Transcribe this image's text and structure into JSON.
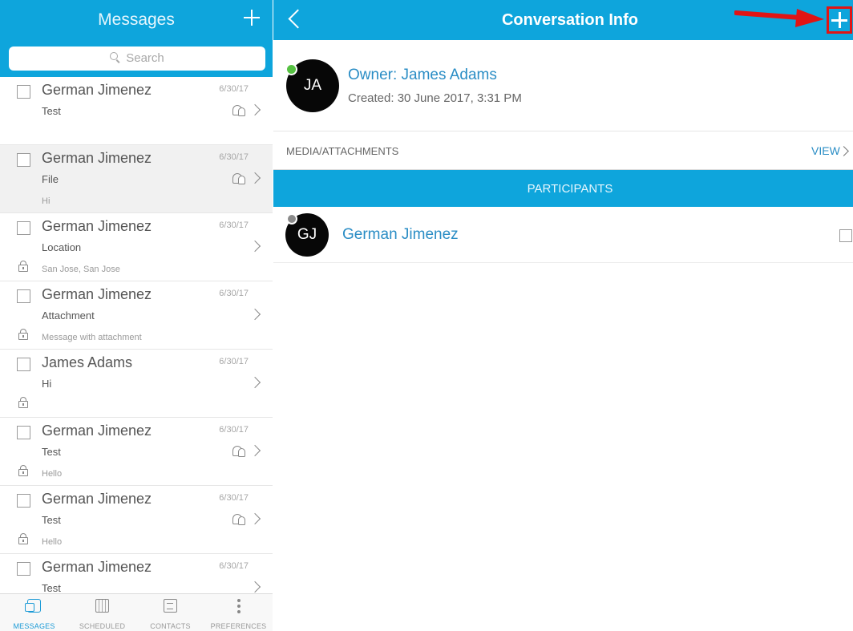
{
  "left": {
    "title": "Messages",
    "search_placeholder": "Search",
    "messages": [
      {
        "sender": "German Jimenez",
        "date": "6/30/17",
        "subject": "Test",
        "preview": "",
        "group": true,
        "lock": false,
        "selected": false
      },
      {
        "sender": "German Jimenez",
        "date": "6/30/17",
        "subject": "File",
        "preview": "Hi",
        "group": true,
        "lock": false,
        "selected": true
      },
      {
        "sender": "German Jimenez",
        "date": "6/30/17",
        "subject": "Location",
        "preview": "San Jose, San Jose",
        "group": false,
        "lock": true,
        "selected": false
      },
      {
        "sender": "German Jimenez",
        "date": "6/30/17",
        "subject": "Attachment",
        "preview": "Message with attachment",
        "group": false,
        "lock": true,
        "selected": false
      },
      {
        "sender": "James Adams",
        "date": "6/30/17",
        "subject": "Hi",
        "preview": "",
        "group": false,
        "lock": true,
        "selected": false
      },
      {
        "sender": "German Jimenez",
        "date": "6/30/17",
        "subject": "Test",
        "preview": "Hello",
        "group": true,
        "lock": true,
        "selected": false
      },
      {
        "sender": "German Jimenez",
        "date": "6/30/17",
        "subject": "Test",
        "preview": "Hello",
        "group": true,
        "lock": true,
        "selected": false
      },
      {
        "sender": "German Jimenez",
        "date": "6/30/17",
        "subject": "Test",
        "preview": "",
        "group": false,
        "lock": false,
        "selected": false
      }
    ],
    "tabs": [
      {
        "label": "MESSAGES",
        "icon": "messages-icon",
        "active": true
      },
      {
        "label": "SCHEDULED",
        "icon": "calendar-icon",
        "active": false
      },
      {
        "label": "CONTACTS",
        "icon": "contacts-icon",
        "active": false
      },
      {
        "label": "PREFERENCES",
        "icon": "more-icon",
        "active": false
      }
    ]
  },
  "right": {
    "title": "Conversation Info",
    "owner": {
      "initials": "JA",
      "name": "Owner: James Adams",
      "created": "Created: 30 June 2017, 3:31 PM",
      "presence_color": "#56c142"
    },
    "media_label": "MEDIA/ATTACHMENTS",
    "view_label": "VIEW",
    "participants_label": "PARTICIPANTS",
    "participants": [
      {
        "initials": "GJ",
        "name": "German Jimenez",
        "presence_color": "#8a8a8a"
      }
    ]
  },
  "colors": {
    "header_blue": "#0ea5dc",
    "link_blue": "#2a8dc5",
    "highlight_red": "#e11414"
  }
}
